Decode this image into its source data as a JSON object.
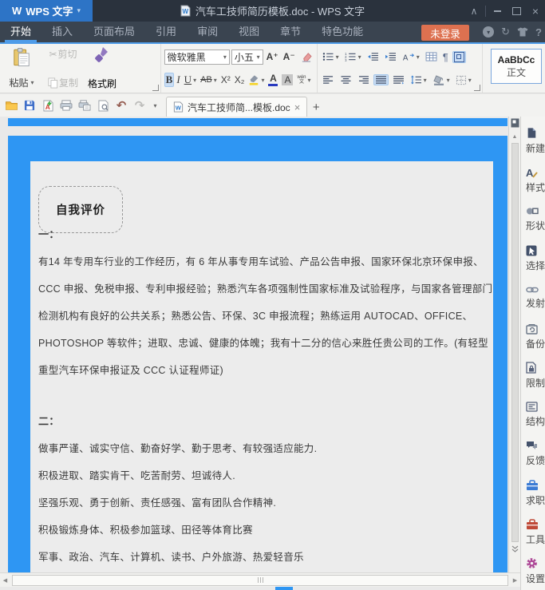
{
  "window": {
    "logo": "W",
    "app_button": "WPS 文字",
    "title": "汽车工技师简历模板.doc - WPS 文字"
  },
  "menu_tabs": [
    {
      "label": "开始",
      "active": true
    },
    {
      "label": "插入"
    },
    {
      "label": "页面布局"
    },
    {
      "label": "引用"
    },
    {
      "label": "审阅"
    },
    {
      "label": "视图"
    },
    {
      "label": "章节"
    },
    {
      "label": "特色功能"
    }
  ],
  "account": {
    "login_label": "未登录",
    "help_label": "?"
  },
  "ribbon": {
    "paste_label": "粘贴",
    "cut_label": "剪切",
    "copy_label": "复制",
    "format_painter_label": "格式刷",
    "font_name": "微软雅黑",
    "font_size": "小五",
    "grow_font": "A⁺",
    "shrink_font": "A⁻",
    "bold": "B",
    "italic": "I",
    "underline": "U",
    "strikethrough": "AB",
    "superscript": "X²",
    "subscript": "X₂",
    "font_color_letter": "A",
    "shading_letter": "A",
    "phonetic_top": "wén",
    "phonetic_bottom": "文",
    "style_preview": "AaBbCc",
    "style_name": "正文"
  },
  "quickbar": {
    "doc_tab_title": "汽车工技师简...模板.doc",
    "new_tab_label": "+"
  },
  "document": {
    "bubble_title": "自我评价",
    "sections": [
      {
        "heading": "一：",
        "lines": [
          "有14 年专用车行业的工作经历，有 6 年从事专用车试验、产品公告申报、国家环保北京环保申报、",
          "CCC 申报、免税申报、专利申报经验；熟悉汽车各项强制性国家标准及试验程序，与国家各管理部门、",
          "检测机构有良好的公共关系；熟悉公告、环保、3C 申报流程；熟练运用 AUTOCAD、OFFICE、",
          "PHOTOSHOP 等软件；进取、忠诚、健康的体魄；我有十二分的信心来胜任贵公司的工作。(有轻型",
          "重型汽车环保申报证及 CCC 认证程师证)"
        ]
      },
      {
        "heading": "二：",
        "lines": [
          "做事严谨、诚实守信、勤奋好学、勤于思考、有较强适应能力.",
          "积极进取、踏实肯干、吃苦耐劳、坦诚待人.",
          "坚强乐观、勇于创新、责任感强、富有团队合作精神.",
          "积极锻炼身体、积极参加篮球、田径等体育比赛",
          "军事、政治、汽车、计算机、读书、户外旅游、热爱轻音乐"
        ]
      }
    ]
  },
  "sidebar": {
    "items": [
      {
        "label": "新建",
        "icon": "new-document-icon"
      },
      {
        "label": "样式",
        "icon": "styles-icon"
      },
      {
        "label": "形状",
        "icon": "shapes-icon"
      },
      {
        "label": "选择",
        "icon": "select-pane-icon"
      },
      {
        "label": "发射",
        "icon": "link-icon"
      },
      {
        "label": "备份",
        "icon": "backup-icon"
      },
      {
        "label": "限制",
        "icon": "restrict-edit-icon"
      },
      {
        "label": "结构",
        "icon": "document-map-icon"
      },
      {
        "label": "反馈",
        "icon": "feedback-icon"
      },
      {
        "label": "求职",
        "icon": "job-toolbox-icon"
      },
      {
        "label": "工具",
        "icon": "tools-toolbox-icon"
      },
      {
        "label": "设置",
        "icon": "settings-gear-icon"
      }
    ]
  },
  "icons": {
    "caret_down": "▾",
    "close": "×",
    "scissors": "✂",
    "undo": "↶",
    "redo": "↷",
    "pilcrow": "¶",
    "refresh": "↻",
    "chevron_up": "∧",
    "left_arrow": "◀",
    "right_arrow": "▶",
    "up_arrow": "▲"
  },
  "colors": {
    "page_blue": "#2E96F3",
    "panel_gray": "#ECECEC",
    "accent_blue": "#4F9CE9",
    "titlebar_dark": "#2A323D",
    "login_orange": "#DD7150",
    "active_toggle": "#C9DDF4"
  }
}
